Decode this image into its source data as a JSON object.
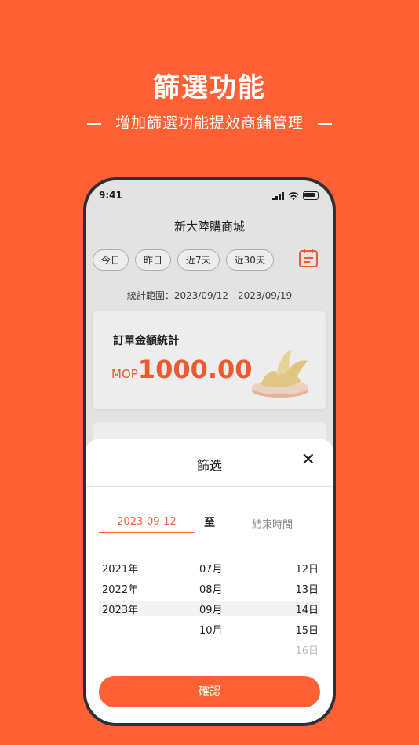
{
  "promo": {
    "title": "篩選功能",
    "subtitle": "增加篩選功能提效商鋪管理"
  },
  "status_bar": {
    "time": "9:41"
  },
  "app": {
    "title": "新大陸購商城",
    "quick_filters": [
      "今日",
      "昨日",
      "近7天",
      "近30天"
    ],
    "range_text": "統計範圍：2023/09/12—2023/09/19",
    "order_card": {
      "title": "訂單金額統計",
      "currency": "MOP",
      "amount": "1000.00"
    }
  },
  "filter_sheet": {
    "title": "篩选",
    "close_icon": "close-icon",
    "start_date": "2023-09-12",
    "to_label": "至",
    "end_placeholder": "結束時間",
    "years": [
      "2021年",
      "2022年",
      "2023年"
    ],
    "months": [
      "07月",
      "08月",
      "09月",
      "10月"
    ],
    "days": [
      "12日",
      "13日",
      "14日",
      "15日",
      "16日"
    ],
    "confirm_label": "確認"
  },
  "colors": {
    "accent": "#ff6135",
    "phone_frame": "#2f3033"
  }
}
